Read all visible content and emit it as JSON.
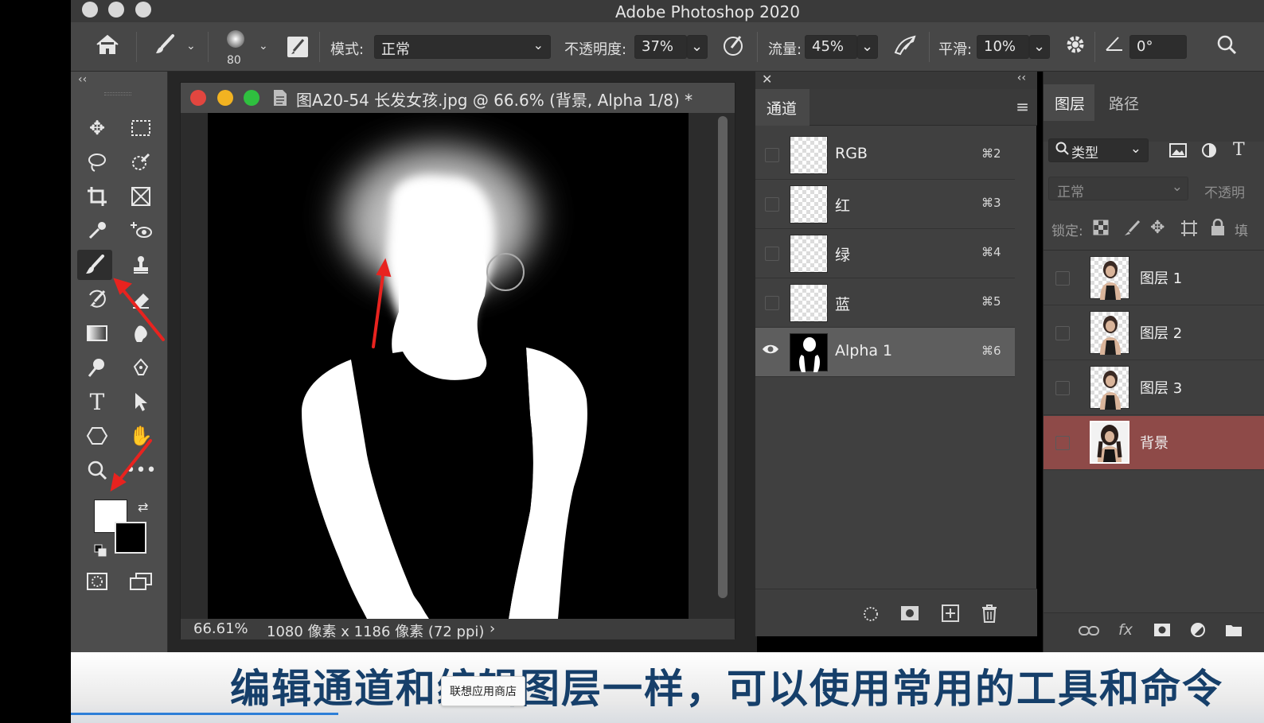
{
  "window": {
    "title": "Adobe Photoshop 2020"
  },
  "options_bar": {
    "brush_size": "80",
    "mode_label": "模式:",
    "mode_value": "正常",
    "opacity_label": "不透明度:",
    "opacity_value": "37%",
    "flow_label": "流量:",
    "flow_value": "45%",
    "smoothing_label": "平滑:",
    "smoothing_value": "10%",
    "angle_value": "0°"
  },
  "document": {
    "title": "图A20-54 长发女孩.jpg @ 66.6% (背景, Alpha 1/8) *",
    "zoom": "66.61%",
    "info": "1080 像素 x 1186 像素 (72 ppi)",
    "info_arrow": "›"
  },
  "channels_panel": {
    "tab": "通道",
    "rows": [
      {
        "name": "RGB",
        "shortcut": "⌘2",
        "visible": false,
        "selected": false
      },
      {
        "name": "红",
        "shortcut": "⌘3",
        "visible": false,
        "selected": false
      },
      {
        "name": "绿",
        "shortcut": "⌘4",
        "visible": false,
        "selected": false
      },
      {
        "name": "蓝",
        "shortcut": "⌘5",
        "visible": false,
        "selected": false
      },
      {
        "name": "Alpha 1",
        "shortcut": "⌘6",
        "visible": true,
        "selected": true
      }
    ]
  },
  "layers_panel": {
    "tabs": [
      "图层",
      "路径"
    ],
    "filter_label": "类型",
    "blend_mode": "正常",
    "opacity_label": "不透明",
    "lock_label": "锁定:",
    "fill_label": "填",
    "layers": [
      {
        "name": "图层 1",
        "selected": false
      },
      {
        "name": "图层 2",
        "selected": false
      },
      {
        "name": "图层 3",
        "selected": false
      },
      {
        "name": "背景",
        "selected": true
      }
    ]
  },
  "colors": {
    "foreground": "#ffffff",
    "background": "#000000",
    "accent_selected_layer": "#8e4a48",
    "subtitle_text": "#163f6a"
  },
  "subtitle": "编辑通道和编辑图层一样，可以使用常用的工具和命令",
  "tooltip": "联想应用商店"
}
